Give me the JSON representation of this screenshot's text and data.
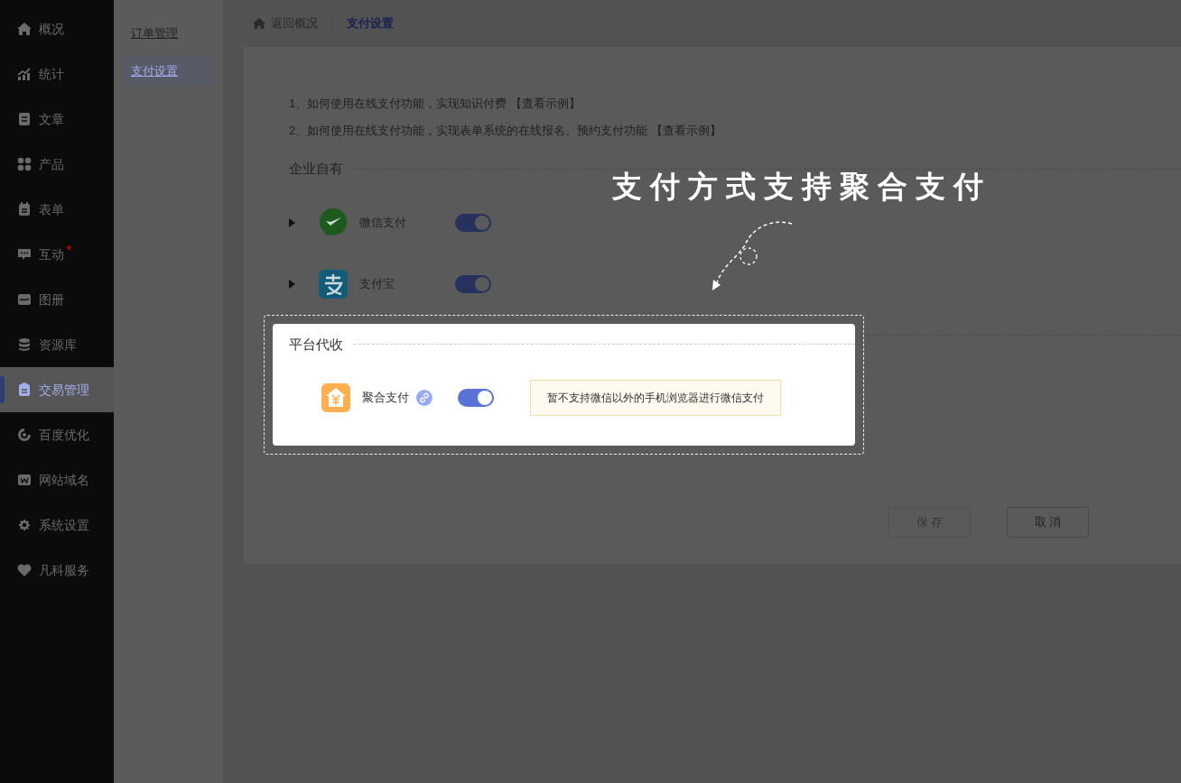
{
  "sidebar": {
    "items": [
      {
        "label": "概况",
        "selected": false,
        "dot": false
      },
      {
        "label": "统计",
        "selected": false,
        "dot": false
      },
      {
        "label": "文章",
        "selected": false,
        "dot": false
      },
      {
        "label": "产品",
        "selected": false,
        "dot": false
      },
      {
        "label": "表单",
        "selected": false,
        "dot": false
      },
      {
        "label": "互动",
        "selected": false,
        "dot": true
      },
      {
        "label": "图册",
        "selected": false,
        "dot": false
      },
      {
        "label": "资源库",
        "selected": false,
        "dot": false
      },
      {
        "label": "交易管理",
        "selected": true,
        "dot": false
      },
      {
        "label": "百度优化",
        "selected": false,
        "dot": false
      },
      {
        "label": "网站域名",
        "selected": false,
        "dot": false
      },
      {
        "label": "系统设置",
        "selected": false,
        "dot": false
      },
      {
        "label": "凡科服务",
        "selected": false,
        "dot": false
      }
    ]
  },
  "subnav": {
    "items": [
      {
        "label": "订单管理",
        "selected": false
      },
      {
        "label": "支付设置",
        "selected": true
      }
    ]
  },
  "breadcrumb": {
    "back": "返回概况",
    "current": "支付设置"
  },
  "help_links": [
    {
      "text": "1、如何使用在线支付功能，实现知识付费",
      "link": "【查看示例】"
    },
    {
      "text": "2、如何使用在线支付功能，实现表单系统的在线报名、预约支付功能",
      "link": "【查看示例】"
    }
  ],
  "sections": [
    {
      "title": "企业自有",
      "highlighted": false,
      "methods": [
        {
          "name": "微信支付",
          "on": true,
          "expandable": true,
          "link_icon": false
        },
        {
          "name": "支付宝",
          "on": true,
          "expandable": true,
          "link_icon": false
        }
      ]
    },
    {
      "title": "平台代收",
      "highlighted": true,
      "methods": [
        {
          "name": "聚合支付",
          "on": true,
          "expandable": false,
          "link_icon": true,
          "notice": "暂不支持微信以外的手机浏览器进行微信支付"
        }
      ]
    }
  ],
  "buttons": [
    {
      "label": "保 存",
      "disabled": true
    },
    {
      "label": "取 消",
      "disabled": false
    }
  ],
  "tutorial": {
    "hint": "支付方式支持聚合支付"
  }
}
